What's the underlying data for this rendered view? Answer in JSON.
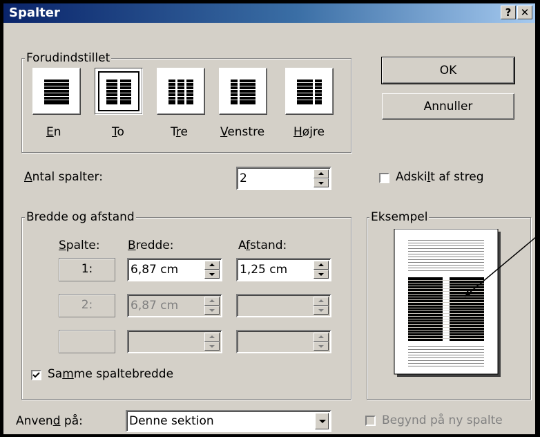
{
  "window": {
    "title": "Spalter",
    "help_button": "?",
    "close_button": "✕"
  },
  "presets": {
    "legend": "Forudindstillet",
    "items": [
      {
        "label": "En",
        "hotkey": "E",
        "rest": "n",
        "selected": false
      },
      {
        "label": "To",
        "hotkey": "T",
        "rest": "o",
        "selected": true
      },
      {
        "label": "Tre",
        "pre": "T",
        "hotkey": "r",
        "rest": "e",
        "selected": false
      },
      {
        "label": "Venstre",
        "hotkey": "V",
        "rest": "enstre",
        "selected": false
      },
      {
        "label": "Højre",
        "hotkey": "H",
        "rest": "øjre",
        "selected": false
      }
    ]
  },
  "buttons": {
    "ok": "OK",
    "cancel": "Annuller"
  },
  "num_columns": {
    "label_hotkey": "A",
    "label_rest": "ntal spalter:",
    "value": "2"
  },
  "separator": {
    "pre": "Adski",
    "hotkey": "l",
    "post": "t af streg",
    "checked": false
  },
  "width_spacing": {
    "legend": "Bredde og afstand",
    "headers": {
      "col_hotkey": "S",
      "col_rest": "palte:",
      "width_hotkey": "B",
      "width_rest": "redde:",
      "spacing_pre": "A",
      "spacing_hotkey": "f",
      "spacing_rest": "stand:"
    },
    "rows": [
      {
        "col": "1:",
        "width": "6,87 cm",
        "spacing": "1,25 cm",
        "enabled": true
      },
      {
        "col": "2:",
        "width": "6,87 cm",
        "spacing": "",
        "enabled": false
      },
      {
        "col": "",
        "width": "",
        "spacing": "",
        "enabled": false
      }
    ],
    "same_width": {
      "pre": "Sa",
      "hotkey": "m",
      "post": "me spaltebredde",
      "checked": true
    }
  },
  "preview": {
    "legend": "Eksempel"
  },
  "apply_to": {
    "pre": "Anven",
    "hotkey": "d",
    "post": " på:",
    "value": "Denne sektion"
  },
  "new_column": {
    "label": "Begynd på ny spalte",
    "checked": false,
    "enabled": false
  }
}
